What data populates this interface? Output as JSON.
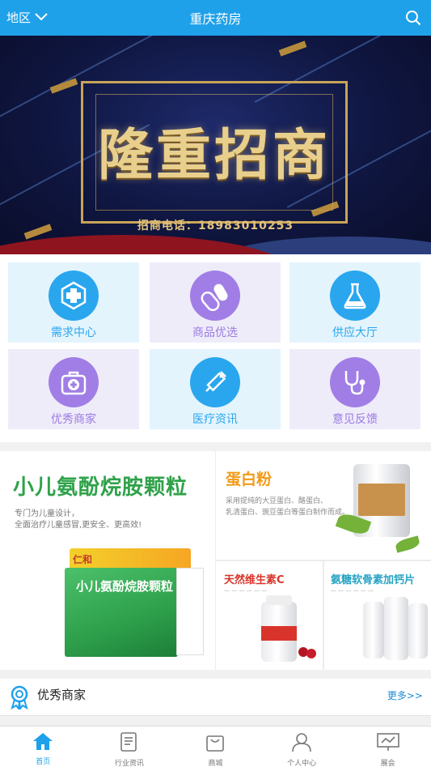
{
  "header": {
    "region_label": "地区",
    "title": "重庆药房",
    "icons": {
      "region_dropdown": "chevron-down-icon",
      "search": "search-icon"
    }
  },
  "banner": {
    "headline": "隆重招商",
    "phone_line": "招商电话：18983010253"
  },
  "grid": {
    "items": [
      {
        "label": "需求中心",
        "icon": "medical-cross-icon",
        "theme": "blue"
      },
      {
        "label": "商品优选",
        "icon": "pills-icon",
        "theme": "purple"
      },
      {
        "label": "供应大厅",
        "icon": "flask-icon",
        "theme": "blue"
      },
      {
        "label": "优秀商家",
        "icon": "medkit-icon",
        "theme": "purple"
      },
      {
        "label": "医疗资讯",
        "icon": "syringe-icon",
        "theme": "blue"
      },
      {
        "label": "意见反馈",
        "icon": "stethoscope-icon",
        "theme": "purple"
      }
    ],
    "colors": {
      "blue": "#2aa6ee",
      "purple": "#a07ee6"
    }
  },
  "ads": {
    "main": {
      "title": "小儿氨酚烷胺颗粒",
      "desc1": "专门为儿童设计，",
      "desc2": "全面治疗儿童感冒,更安全、更高效!",
      "box_brand": "仁和",
      "box_name": "小儿氨酚烷胺颗粒"
    },
    "protein": {
      "title": "蛋白粉",
      "desc1": "采用提纯的大豆蛋白、酪蛋白、",
      "desc2": "乳清蛋白、豌豆蛋白等蛋白制作而成。"
    },
    "vitamin_c": {
      "title": "天然维生素C"
    },
    "calcium": {
      "title": "氨糖软骨素加钙片"
    }
  },
  "merchants": {
    "label": "优秀商家",
    "more": "更多>>"
  },
  "tabbar": {
    "tabs": [
      {
        "label": "首页",
        "icon": "home-icon",
        "active": true
      },
      {
        "label": "行业资讯",
        "icon": "news-icon",
        "active": false
      },
      {
        "label": "商城",
        "icon": "shopping-bag-icon",
        "active": false
      },
      {
        "label": "个人中心",
        "icon": "user-icon",
        "active": false
      },
      {
        "label": "展会",
        "icon": "exhibition-icon",
        "active": false
      }
    ]
  }
}
